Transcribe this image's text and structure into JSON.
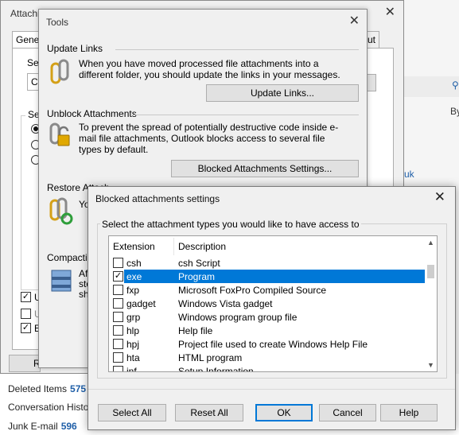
{
  "outlook_bg": {
    "folders": [
      {
        "name": "Deleted Items",
        "count": "575"
      },
      {
        "name": "Conversation Histo",
        "count": ""
      },
      {
        "name": "Junk E-mail",
        "count": "596"
      }
    ],
    "right_fragment_1": "By",
    "right_fragment_2": "uk"
  },
  "attach_window": {
    "title": "Attachr",
    "tab_general": "Genera",
    "tab_right": "ut",
    "sel_label_1": "Sel",
    "field_fragment": "C",
    "sel_label_2": "Sel",
    "check_u1": "U",
    "check_u2": "U",
    "check_e": "E",
    "bottom_button": "R"
  },
  "tools_dialog": {
    "title": "Tools",
    "update_links": {
      "header": "Update Links",
      "text": "When you have moved processed file attachments into a different folder, you should update the links in your messages.",
      "button": "Update Links..."
    },
    "unblock": {
      "header": "Unblock Attachments",
      "text": "To prevent the spread of potentially destructive code inside e-mail file attachments, Outlook blocks access to several file types by default.",
      "button": "Blocked Attachments Settings..."
    },
    "restore": {
      "header": "Restore Attach",
      "text": "Yo"
    },
    "compacting": {
      "header": "Compacting",
      "text_lines": [
        "Af",
        "sto",
        "sh"
      ]
    }
  },
  "blocked_dialog": {
    "title": "Blocked attachments settings",
    "group_label": "Select the attachment types you would like to have access to",
    "columns": {
      "extension": "Extension",
      "description": "Description"
    },
    "rows": [
      {
        "ext": "csh",
        "desc": "csh Script",
        "checked": false,
        "selected": false
      },
      {
        "ext": "exe",
        "desc": "Program",
        "checked": true,
        "selected": true
      },
      {
        "ext": "fxp",
        "desc": "Microsoft FoxPro Compiled Source",
        "checked": false,
        "selected": false
      },
      {
        "ext": "gadget",
        "desc": "Windows Vista gadget",
        "checked": false,
        "selected": false
      },
      {
        "ext": "grp",
        "desc": "Windows program group file",
        "checked": false,
        "selected": false
      },
      {
        "ext": "hlp",
        "desc": "Help file",
        "checked": false,
        "selected": false
      },
      {
        "ext": "hpj",
        "desc": "Project file used to create Windows Help File",
        "checked": false,
        "selected": false
      },
      {
        "ext": "hta",
        "desc": "HTML program",
        "checked": false,
        "selected": false
      },
      {
        "ext": "inf",
        "desc": "Setup Information",
        "checked": false,
        "selected": false
      }
    ],
    "buttons": {
      "select_all": "Select All",
      "reset_all": "Reset All",
      "ok": "OK",
      "cancel": "Cancel",
      "help": "Help"
    }
  },
  "colors": {
    "selection": "#0078d7",
    "dialog_bg": "#f0f0f0",
    "count_blue": "#1f5fa8"
  }
}
